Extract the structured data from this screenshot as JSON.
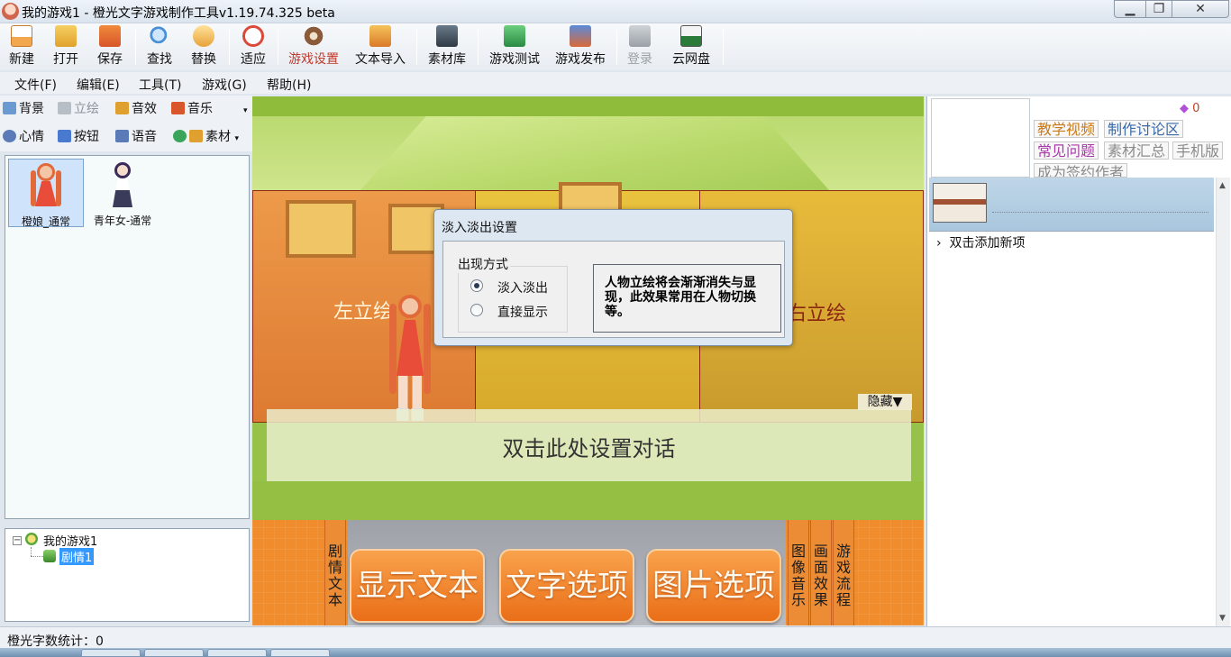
{
  "window": {
    "title": "我的游戏1 - 橙光文字游戏制作工具v1.19.74.325 beta"
  },
  "toolbar": {
    "items": [
      {
        "label": "新建",
        "icon": "new-file-icon",
        "color": "#f08a3c"
      },
      {
        "label": "打开",
        "icon": "open-folder-icon",
        "color": "#f0b030"
      },
      {
        "label": "保存",
        "icon": "save-icon",
        "color": "#e55a2b"
      },
      {
        "label": "查找",
        "icon": "search-icon",
        "color": "#4a90d9"
      },
      {
        "label": "替换",
        "icon": "replace-icon",
        "color": "#e8a23a"
      },
      {
        "label": "适应",
        "icon": "fit-icon",
        "color": "#d94a3a"
      },
      {
        "label": "游戏设置",
        "icon": "gear-icon",
        "color": "#8a5a3a"
      },
      {
        "label": "文本导入",
        "icon": "text-import-icon",
        "color": "#e08b2a"
      },
      {
        "label": "素材库",
        "icon": "media-library-icon",
        "color": "#5a6a7a"
      },
      {
        "label": "游戏测试",
        "icon": "play-test-icon",
        "color": "#3aa55a"
      },
      {
        "label": "游戏发布",
        "icon": "publish-icon",
        "color": "#d96a3a"
      },
      {
        "label": "登录",
        "icon": "login-icon",
        "color": "#9aa0a6"
      },
      {
        "label": "云网盘",
        "icon": "cloud-drive-icon",
        "color": "#2a7a3a"
      }
    ]
  },
  "menu": {
    "items": [
      "文件(F)",
      "编辑(E)",
      "工具(T)",
      "游戏(G)",
      "帮助(H)"
    ]
  },
  "left_tabs": {
    "row1": [
      "背景",
      "立绘",
      "音效",
      "音乐"
    ],
    "row2": [
      "心情",
      "按钮",
      "语音",
      "素材"
    ]
  },
  "characters": [
    {
      "name": "橙娘_通常",
      "selected": true
    },
    {
      "name": "青年女-通常",
      "selected": false
    }
  ],
  "tree": {
    "root": "我的游戏1",
    "child": "剧情1",
    "expand_symbol": "−"
  },
  "stage": {
    "left_label": "左立绘",
    "right_label": "右立绘",
    "hide_button": "隐藏▼",
    "dialog_text": "双击此处设置对话"
  },
  "fade_dialog": {
    "title": "淡入淡出设置",
    "group_title": "出现方式",
    "options": [
      {
        "label": "淡入淡出",
        "checked": true
      },
      {
        "label": "直接显示",
        "checked": false
      }
    ],
    "description": "人物立绘将会渐渐消失与显现，此效果常用在人物切换等。"
  },
  "commands": {
    "left_tab": "剧情文本",
    "buttons": [
      "显示文本",
      "文字选项",
      "图片选项"
    ],
    "right_tabs": [
      "图像音乐",
      "画面效果",
      "游戏流程"
    ]
  },
  "right_panel": {
    "gem_count": "0",
    "links": [
      {
        "label": "教学视频",
        "color": "#c97a1a"
      },
      {
        "label": "制作讨论区",
        "color": "#3a6aa8"
      },
      {
        "label": "常见问题",
        "color": "#a83aa8"
      },
      {
        "label": "素材汇总",
        "color": "#8a8a8a"
      },
      {
        "label": "手机版",
        "color": "#8a8a8a"
      },
      {
        "label": "成为签约作者",
        "color": "#8a8a8a"
      }
    ],
    "add_item": "双击添加新项"
  },
  "status": {
    "text": "橙光字数统计：0"
  },
  "colors": {
    "accent": "#c0392b",
    "stage_green": "#97c24a",
    "command_orange": "#f08c2c"
  }
}
